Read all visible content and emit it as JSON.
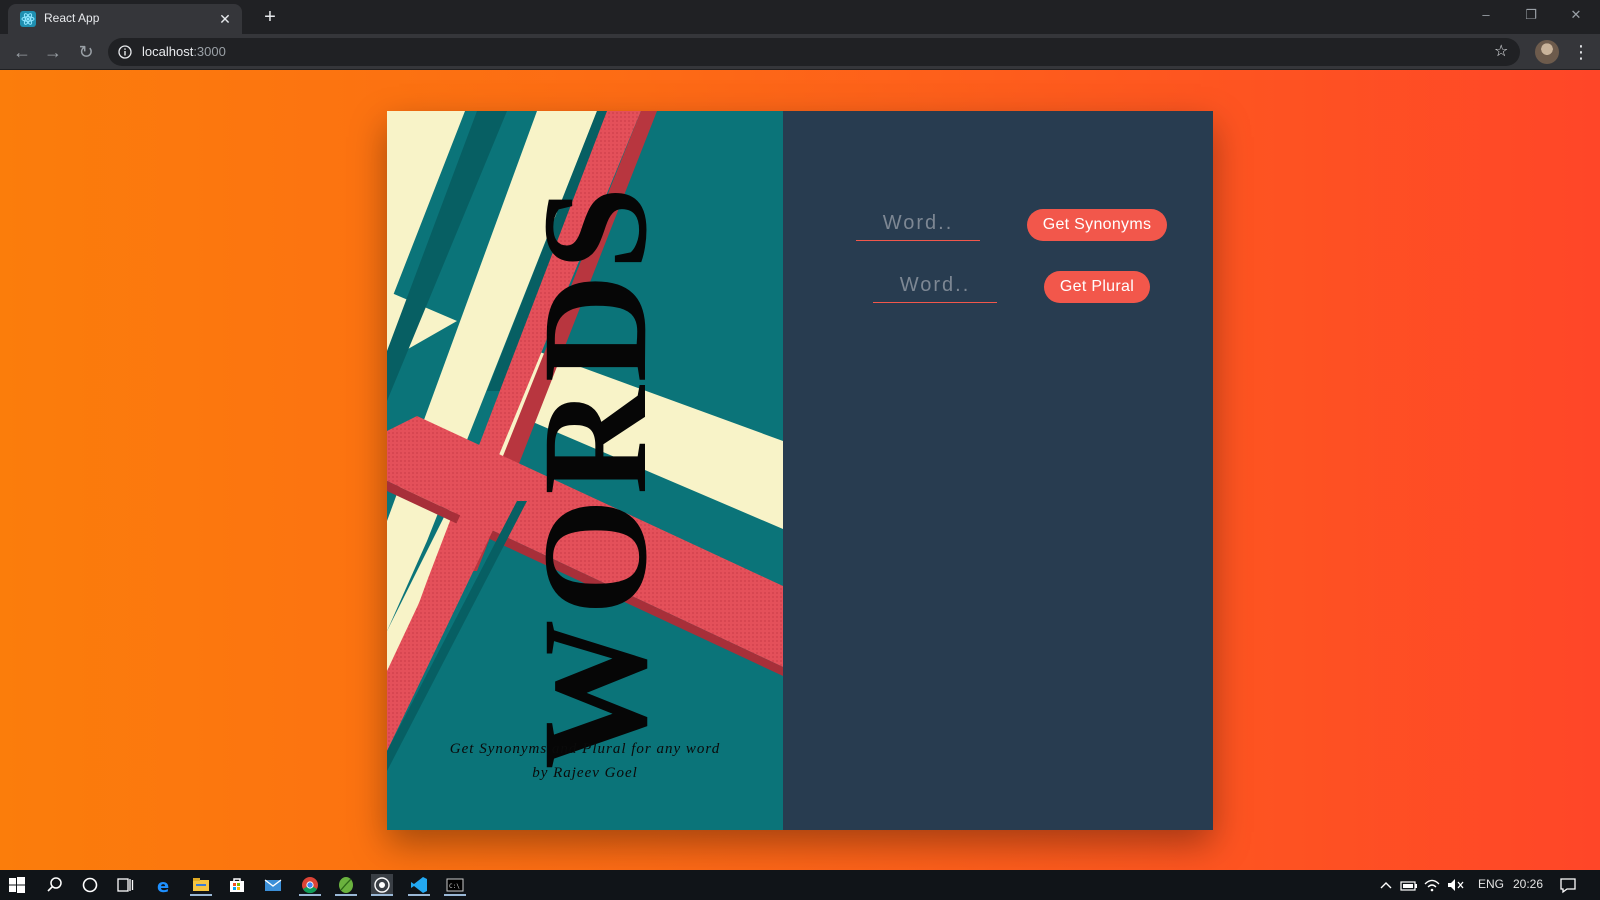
{
  "browser": {
    "tab_title": "React App",
    "url_host": "localhost",
    "url_port": ":3000"
  },
  "cover": {
    "title": "WORDS",
    "tagline": "Get Synonyms and Plural for any word",
    "author": "by Rajeev Goel"
  },
  "form": {
    "synonyms": {
      "input_placeholder": "Word..",
      "input_value": "",
      "button_label": "Get Synonyms"
    },
    "plural": {
      "input_placeholder": "Word..",
      "input_value": "",
      "button_label": "Get Plural"
    }
  },
  "taskbar": {
    "language": "ENG",
    "time": "20:26"
  },
  "colors": {
    "accent": "#f2574b",
    "panel": "#283c50",
    "cover_teal": "#0b7479",
    "cover_cream": "#f8f3c8",
    "gradient_start": "#fb7d0b",
    "gradient_end": "#ff4628"
  }
}
